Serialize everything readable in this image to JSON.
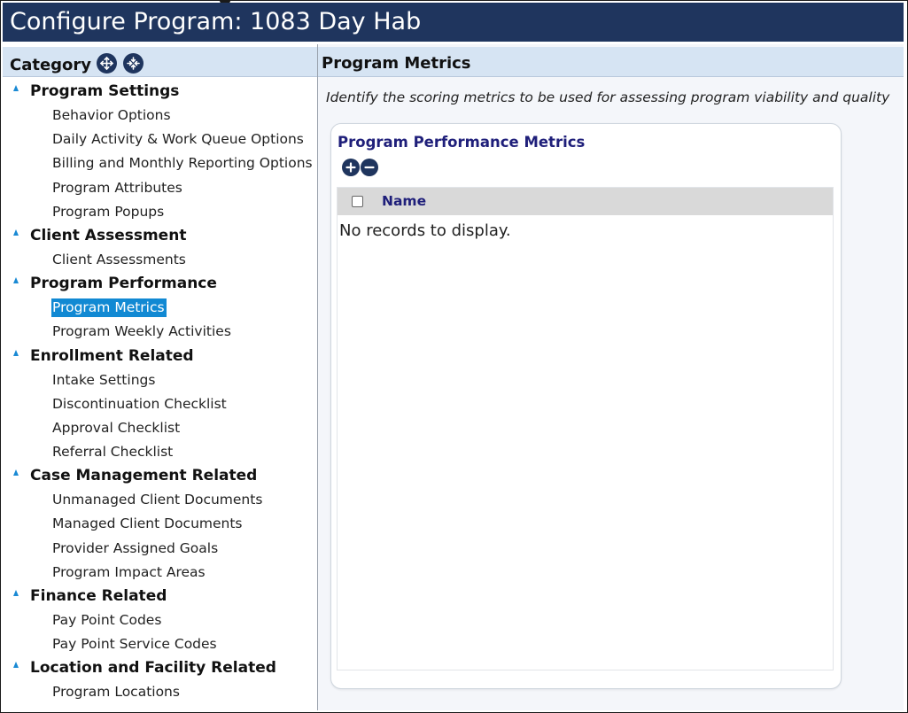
{
  "window": {
    "title": "Configure Program: 1083 Day Hab"
  },
  "left": {
    "header": "Category",
    "expand_icon": "expand-all-icon",
    "collapse_icon": "collapse-all-icon",
    "groups": [
      {
        "title": "Program Settings",
        "items": [
          "Behavior Options",
          "Daily Activity & Work Queue Options",
          "Billing and Monthly Reporting Options",
          "Program Attributes",
          "Program Popups"
        ]
      },
      {
        "title": "Client Assessment",
        "items": [
          "Client Assessments"
        ]
      },
      {
        "title": "Program Performance",
        "items": [
          "Program Metrics",
          "Program Weekly Activities"
        ]
      },
      {
        "title": "Enrollment Related",
        "items": [
          "Intake Settings",
          "Discontinuation Checklist",
          "Approval Checklist",
          "Referral Checklist"
        ]
      },
      {
        "title": "Case Management Related",
        "items": [
          "Unmanaged Client Documents",
          "Managed Client Documents",
          "Provider Assigned Goals",
          "Program Impact Areas"
        ]
      },
      {
        "title": "Finance Related",
        "items": [
          "Pay Point Codes",
          "Pay Point Service Codes"
        ]
      },
      {
        "title": "Location and Facility Related",
        "items": [
          "Program Locations"
        ]
      }
    ],
    "selected": "Program Metrics"
  },
  "right": {
    "header": "Program Metrics",
    "description": "Identify the scoring metrics to be used for assessing program viability and quality",
    "card": {
      "title": "Program Performance Metrics",
      "add_icon": "plus-circle-icon",
      "remove_icon": "minus-circle-icon",
      "columns": [
        "Name"
      ],
      "empty_text": "No records to display."
    }
  },
  "colors": {
    "title_bar": "#1f355e",
    "header_band": "#d6e4f3",
    "selection": "#1189d3",
    "tree_arrow": "#1a8ad4",
    "accent_text": "#1f1f7a"
  }
}
